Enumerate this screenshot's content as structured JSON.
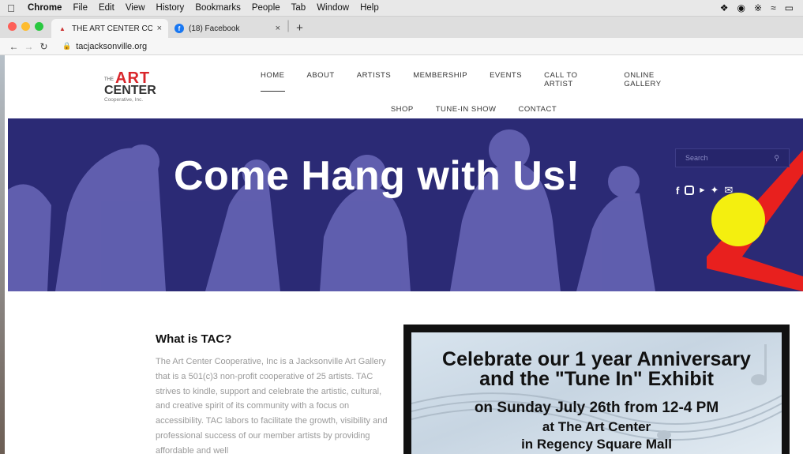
{
  "menubar": {
    "app": "Chrome",
    "items": [
      "File",
      "Edit",
      "View",
      "History",
      "Bookmarks",
      "People",
      "Tab",
      "Window",
      "Help"
    ]
  },
  "tabs": [
    {
      "title": "THE ART CENTER COOPERATI",
      "favicon": "art-center-favicon"
    },
    {
      "title": "(18) Facebook",
      "favicon": "facebook-icon"
    }
  ],
  "address": {
    "url": "tacjacksonville.org"
  },
  "logo": {
    "the": "THE",
    "art": "ART",
    "center": "CENTER",
    "coop": "Cooperative, Inc."
  },
  "nav": {
    "row1": [
      "HOME",
      "ABOUT",
      "ARTISTS",
      "MEMBERSHIP",
      "EVENTS",
      "CALL TO ARTIST",
      "ONLINE GALLERY"
    ],
    "row2": [
      "SHOP",
      "TUNE-IN SHOW",
      "CONTACT"
    ]
  },
  "hero": {
    "title": "Come Hang with Us!",
    "search_placeholder": "Search",
    "social_icons": [
      "facebook-icon",
      "instagram-icon",
      "youtube-icon",
      "twitter-icon",
      "email-icon"
    ]
  },
  "about": {
    "heading": "What is TAC?",
    "body": "The Art Center Cooperative, Inc is a Jacksonville Art Gallery that is a 501(c)3 non-profit cooperative of 25 artists.  TAC strives to kindle, support and celebrate the artistic, cultural, and creative spirit of its community with a focus on accessibility.  TAC labors to facilitate the growth, visibility and professional success of our member artists by providing affordable and well"
  },
  "poster": {
    "line1": "Celebrate our 1 year Anniversary",
    "line2": "and the \"Tune In\" Exhibit",
    "line3": "on Sunday July 26th from 12-4 PM",
    "line4": "at The Art Center",
    "line5": "in Regency Square Mall"
  },
  "colors": {
    "hero_bg": "#2b2a75",
    "accent_red": "#e8201e",
    "accent_yellow": "#f4ef0f"
  }
}
